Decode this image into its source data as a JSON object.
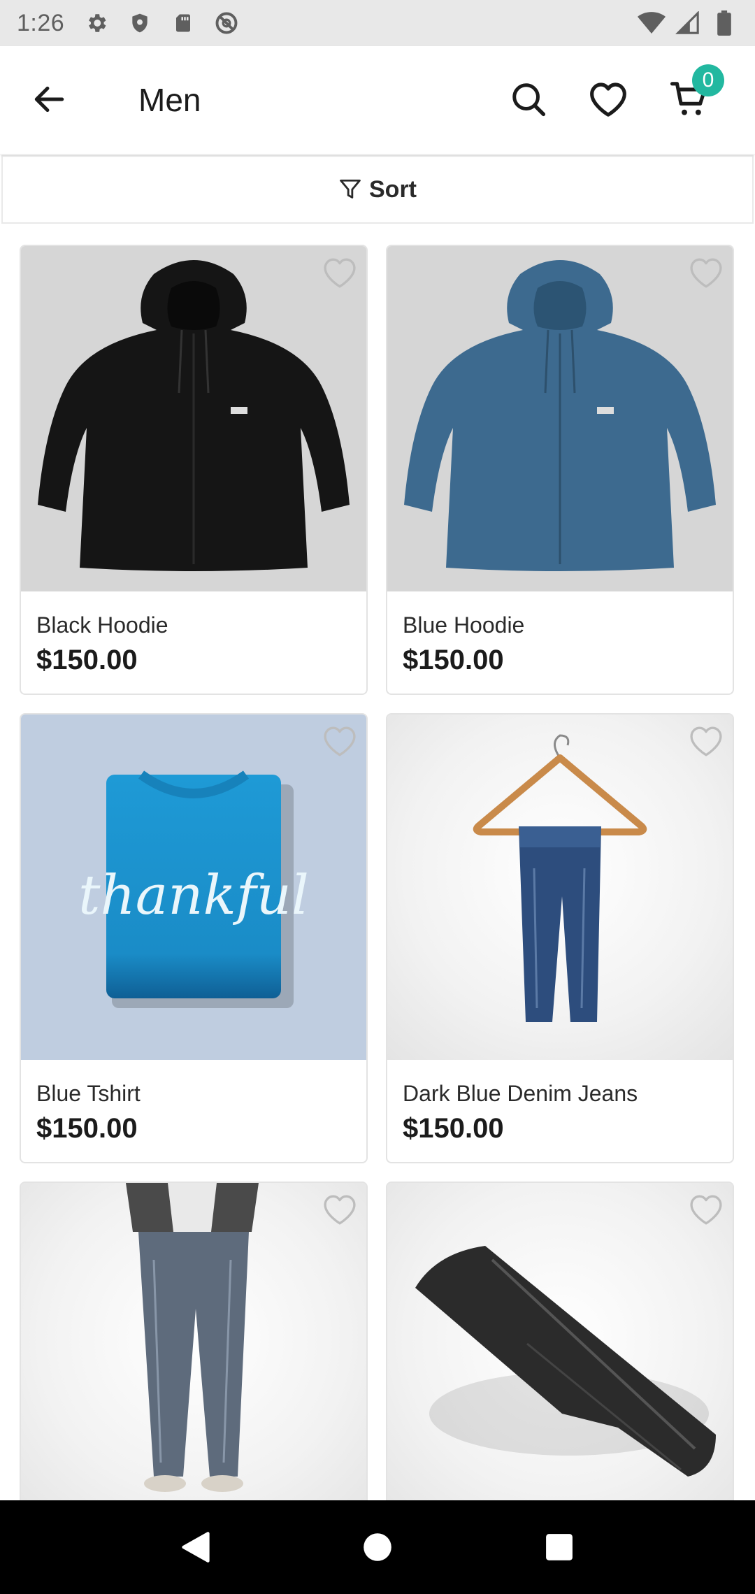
{
  "status_bar": {
    "time": "1:26",
    "icons_left": [
      "gear-icon",
      "shield-icon",
      "sd-card-icon",
      "no-sync-icon"
    ],
    "icons_right": [
      "wifi-icon",
      "signal-icon",
      "battery-icon"
    ]
  },
  "app_bar": {
    "title": "Men",
    "cart_count": "0",
    "accent_color": "#22b8a0"
  },
  "sort": {
    "label": "Sort"
  },
  "products": [
    {
      "name": "Black Hoodie",
      "price": "$150.00"
    },
    {
      "name": "Blue Hoodie",
      "price": "$150.00"
    },
    {
      "name": "Blue Tshirt",
      "price": "$150.00",
      "print_text": "thankful"
    },
    {
      "name": "Dark Blue Denim Jeans",
      "price": "$150.00"
    },
    {
      "name": "",
      "price": ""
    },
    {
      "name": "",
      "price": ""
    }
  ],
  "nav": [
    "back-triangle-icon",
    "home-circle-icon",
    "recents-square-icon"
  ]
}
